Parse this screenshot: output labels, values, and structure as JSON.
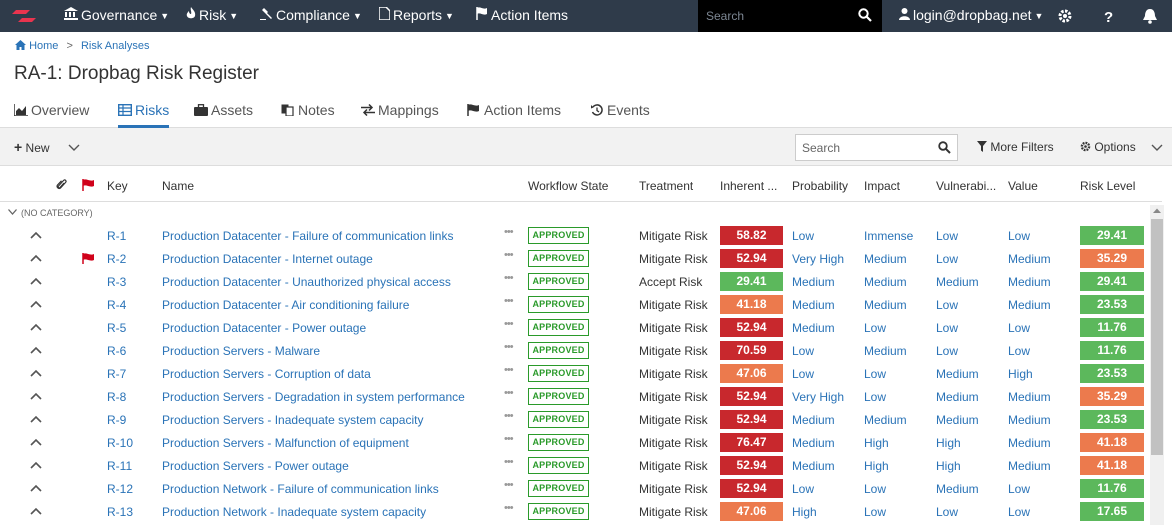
{
  "nav": {
    "governance": "Governance",
    "risk": "Risk",
    "compliance": "Compliance",
    "reports": "Reports",
    "action_items": "Action Items",
    "search_placeholder": "Search",
    "user": "login@dropbag.net"
  },
  "breadcrumb": {
    "home": "Home",
    "current": "Risk Analyses"
  },
  "page_title": "RA-1: Dropbag Risk Register",
  "tabs": [
    "Overview",
    "Risks",
    "Assets",
    "Notes",
    "Mappings",
    "Action Items",
    "Events"
  ],
  "toolbar": {
    "new_label": "New",
    "search_placeholder": "Search",
    "more_filters": "More Filters",
    "options": "Options"
  },
  "columns": [
    "Key",
    "Name",
    "Workflow State",
    "Treatment",
    "Inherent ...",
    "Probability",
    "Impact",
    "Vulnerabi...",
    "Value",
    "Risk Level"
  ],
  "category": "(NO CATEGORY)",
  "colors": {
    "dark_red": "#c8282d",
    "orange": "#ec7a4d",
    "green": "#5cb85c",
    "link": "#2a73b7",
    "nav_bg": "#2f3b4a"
  },
  "rows": [
    {
      "key": "R-1",
      "name": "Production Datacenter - Failure of communication links",
      "state": "APPROVED",
      "treatment": "Mitigate Risk",
      "inherent": "58.82",
      "inherent_level": "dark_red",
      "probability": "Low",
      "impact": "Immense",
      "vulnerability": "Low",
      "value": "Low",
      "risk": "29.41",
      "risk_level": "green",
      "flag": false
    },
    {
      "key": "R-2",
      "name": "Production Datacenter - Internet outage",
      "state": "APPROVED",
      "treatment": "Mitigate Risk",
      "inherent": "52.94",
      "inherent_level": "dark_red",
      "probability": "Very High",
      "impact": "Medium",
      "vulnerability": "Low",
      "value": "Medium",
      "risk": "35.29",
      "risk_level": "orange",
      "flag": true
    },
    {
      "key": "R-3",
      "name": "Production Datacenter - Unauthorized physical access",
      "state": "APPROVED",
      "treatment": "Accept Risk",
      "inherent": "29.41",
      "inherent_level": "green",
      "probability": "Medium",
      "impact": "Medium",
      "vulnerability": "Medium",
      "value": "Medium",
      "risk": "29.41",
      "risk_level": "green",
      "flag": false
    },
    {
      "key": "R-4",
      "name": "Production Datacenter - Air conditioning failure",
      "state": "APPROVED",
      "treatment": "Mitigate Risk",
      "inherent": "41.18",
      "inherent_level": "orange",
      "probability": "Medium",
      "impact": "Medium",
      "vulnerability": "Low",
      "value": "Medium",
      "risk": "23.53",
      "risk_level": "green",
      "flag": false
    },
    {
      "key": "R-5",
      "name": "Production Datacenter - Power outage",
      "state": "APPROVED",
      "treatment": "Mitigate Risk",
      "inherent": "52.94",
      "inherent_level": "dark_red",
      "probability": "Medium",
      "impact": "Low",
      "vulnerability": "Low",
      "value": "Low",
      "risk": "11.76",
      "risk_level": "green",
      "flag": false
    },
    {
      "key": "R-6",
      "name": "Production Servers - Malware",
      "state": "APPROVED",
      "treatment": "Mitigate Risk",
      "inherent": "70.59",
      "inherent_level": "dark_red",
      "probability": "Low",
      "impact": "Medium",
      "vulnerability": "Low",
      "value": "Low",
      "risk": "11.76",
      "risk_level": "green",
      "flag": false
    },
    {
      "key": "R-7",
      "name": "Production Servers - Corruption of data",
      "state": "APPROVED",
      "treatment": "Mitigate Risk",
      "inherent": "47.06",
      "inherent_level": "orange",
      "probability": "Low",
      "impact": "Low",
      "vulnerability": "Medium",
      "value": "High",
      "risk": "23.53",
      "risk_level": "green",
      "flag": false
    },
    {
      "key": "R-8",
      "name": "Production Servers - Degradation in system performance",
      "state": "APPROVED",
      "treatment": "Mitigate Risk",
      "inherent": "52.94",
      "inherent_level": "dark_red",
      "probability": "Very High",
      "impact": "Low",
      "vulnerability": "Medium",
      "value": "Medium",
      "risk": "35.29",
      "risk_level": "orange",
      "flag": false
    },
    {
      "key": "R-9",
      "name": "Production Servers - Inadequate system capacity",
      "state": "APPROVED",
      "treatment": "Mitigate Risk",
      "inherent": "52.94",
      "inherent_level": "dark_red",
      "probability": "Medium",
      "impact": "Medium",
      "vulnerability": "Medium",
      "value": "Medium",
      "risk": "23.53",
      "risk_level": "green",
      "flag": false
    },
    {
      "key": "R-10",
      "name": "Production Servers - Malfunction of equipment",
      "state": "APPROVED",
      "treatment": "Mitigate Risk",
      "inherent": "76.47",
      "inherent_level": "dark_red",
      "probability": "Medium",
      "impact": "High",
      "vulnerability": "High",
      "value": "Medium",
      "risk": "41.18",
      "risk_level": "orange",
      "flag": false
    },
    {
      "key": "R-11",
      "name": "Production Servers - Power outage",
      "state": "APPROVED",
      "treatment": "Mitigate Risk",
      "inherent": "52.94",
      "inherent_level": "dark_red",
      "probability": "Medium",
      "impact": "High",
      "vulnerability": "High",
      "value": "Medium",
      "risk": "41.18",
      "risk_level": "orange",
      "flag": false
    },
    {
      "key": "R-12",
      "name": "Production Network - Failure of communication links",
      "state": "APPROVED",
      "treatment": "Mitigate Risk",
      "inherent": "52.94",
      "inherent_level": "dark_red",
      "probability": "Low",
      "impact": "Low",
      "vulnerability": "Medium",
      "value": "Low",
      "risk": "11.76",
      "risk_level": "green",
      "flag": false
    },
    {
      "key": "R-13",
      "name": "Production Network - Inadequate system capacity",
      "state": "APPROVED",
      "treatment": "Mitigate Risk",
      "inherent": "47.06",
      "inherent_level": "orange",
      "probability": "High",
      "impact": "Low",
      "vulnerability": "Low",
      "value": "Low",
      "risk": "17.65",
      "risk_level": "green",
      "flag": false
    }
  ]
}
